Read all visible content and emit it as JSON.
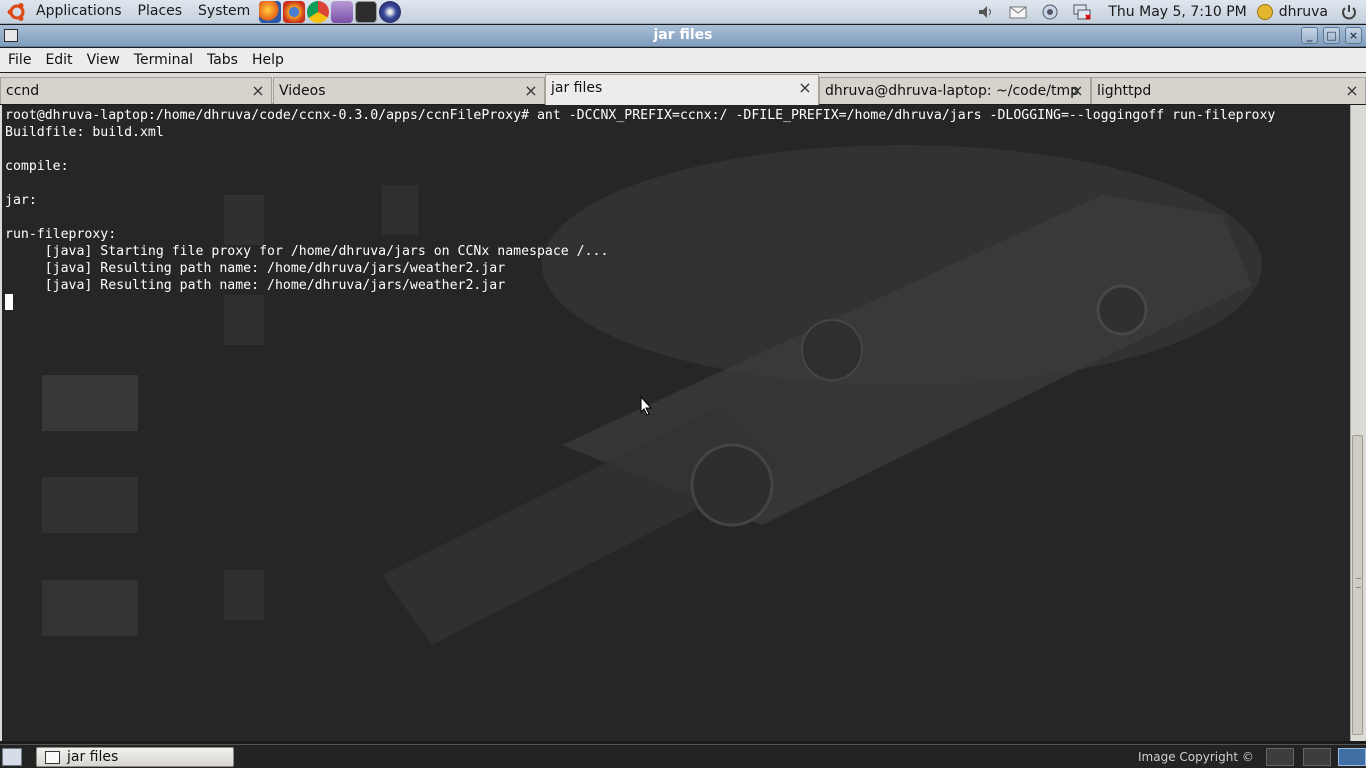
{
  "top_panel": {
    "menus": [
      "Applications",
      "Places",
      "System"
    ],
    "launchers": [
      "firefox-icon",
      "chromium-icon",
      "pidgin-icon",
      "terminal-icon",
      "eclipse-icon"
    ],
    "clock": "Thu May  5, 7:10 PM",
    "user": "dhruva"
  },
  "window": {
    "title": "jar files"
  },
  "menu_bar": {
    "items": [
      "File",
      "Edit",
      "View",
      "Terminal",
      "Tabs",
      "Help"
    ]
  },
  "tabs": [
    {
      "label": "ccnd",
      "active": false
    },
    {
      "label": "Videos",
      "active": false
    },
    {
      "label": "jar files",
      "active": true
    },
    {
      "label": "dhruva@dhruva-laptop: ~/code/tmp",
      "active": false
    },
    {
      "label": "lighttpd",
      "active": false
    }
  ],
  "terminal": {
    "lines": [
      "root@dhruva-laptop:/home/dhruva/code/ccnx-0.3.0/apps/ccnFileProxy# ant -DCCNX_PREFIX=ccnx:/ -DFILE_PREFIX=/home/dhruva/jars -DLOGGING=--loggingoff run-fileproxy",
      "Buildfile: build.xml",
      "",
      "compile:",
      "",
      "jar:",
      "",
      "run-fileproxy:",
      "     [java] Starting file proxy for /home/dhruva/jars on CCNx namespace /...",
      "     [java] Resulting path name: /home/dhruva/jars/weather2.jar",
      "     [java] Resulting path name: /home/dhruva/jars/weather2.jar"
    ]
  },
  "bottom_panel": {
    "task": "jar files",
    "copyright": "Image Copyright ©"
  },
  "colors": {
    "terminal_bg": "#272727",
    "terminal_fg": "#ffffff",
    "title_bar": "#8fabc9"
  }
}
